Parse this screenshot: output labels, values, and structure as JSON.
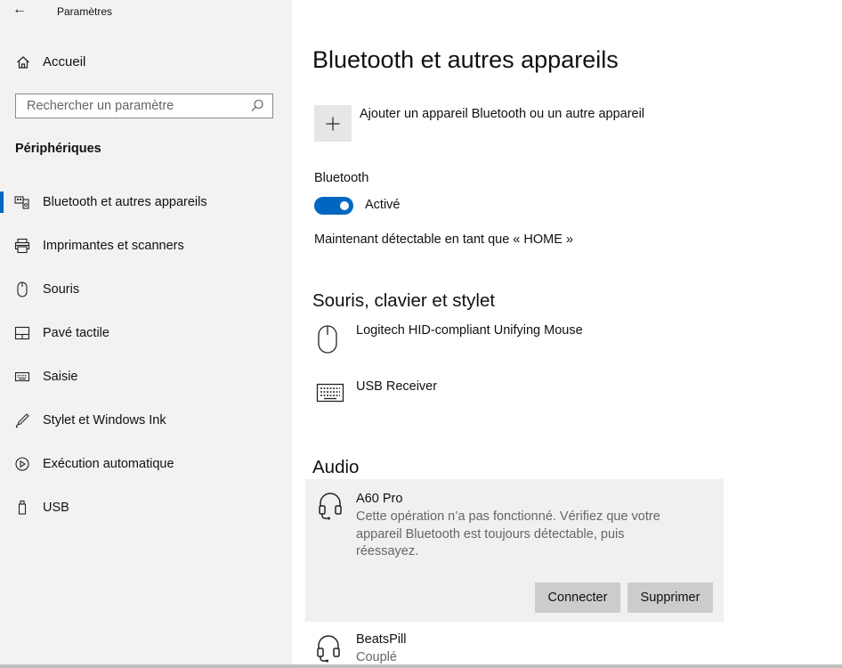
{
  "window": {
    "title": "Paramètres"
  },
  "sidebar": {
    "home_label": "Accueil",
    "search_placeholder": "Rechercher un paramètre",
    "section_title": "Périphériques",
    "items": [
      {
        "label": "Bluetooth et autres appareils",
        "icon": "bluetooth-devices-icon",
        "active": true
      },
      {
        "label": "Imprimantes et scanners",
        "icon": "printer-icon",
        "active": false
      },
      {
        "label": "Souris",
        "icon": "mouse-icon",
        "active": false
      },
      {
        "label": "Pavé tactile",
        "icon": "touchpad-icon",
        "active": false
      },
      {
        "label": "Saisie",
        "icon": "keyboard-icon",
        "active": false
      },
      {
        "label": "Stylet et Windows Ink",
        "icon": "pen-icon",
        "active": false
      },
      {
        "label": "Exécution automatique",
        "icon": "autoplay-icon",
        "active": false
      },
      {
        "label": "USB",
        "icon": "usb-icon",
        "active": false
      }
    ]
  },
  "main": {
    "title": "Bluetooth et autres appareils",
    "add_device_label": "Ajouter un appareil Bluetooth ou un autre appareil",
    "bluetooth_label": "Bluetooth",
    "bluetooth_state": "Activé",
    "discoverable_text": "Maintenant détectable en tant que « HOME »",
    "input_section_title": "Souris, clavier et stylet",
    "input_devices": [
      {
        "name": "Logitech HID-compliant Unifying Mouse",
        "icon": "mouse-icon"
      },
      {
        "name": "USB Receiver",
        "icon": "keyboard-icon"
      }
    ],
    "audio_section_title": "Audio",
    "audio_devices": [
      {
        "name": "A60 Pro",
        "icon": "headset-icon",
        "message": "Cette opération n’a pas fonctionné. Vérifiez que votre appareil Bluetooth est toujours détectable, puis réessayez.",
        "connect_label": "Connecter",
        "remove_label": "Supprimer"
      },
      {
        "name": "BeatsPill",
        "icon": "headset-icon",
        "status": "Couplé"
      }
    ]
  },
  "colors": {
    "accent": "#0067c0",
    "sidebar_bg": "#f2f2f2",
    "card_bg": "#f0f0f0",
    "button_bg": "#cccccc"
  }
}
